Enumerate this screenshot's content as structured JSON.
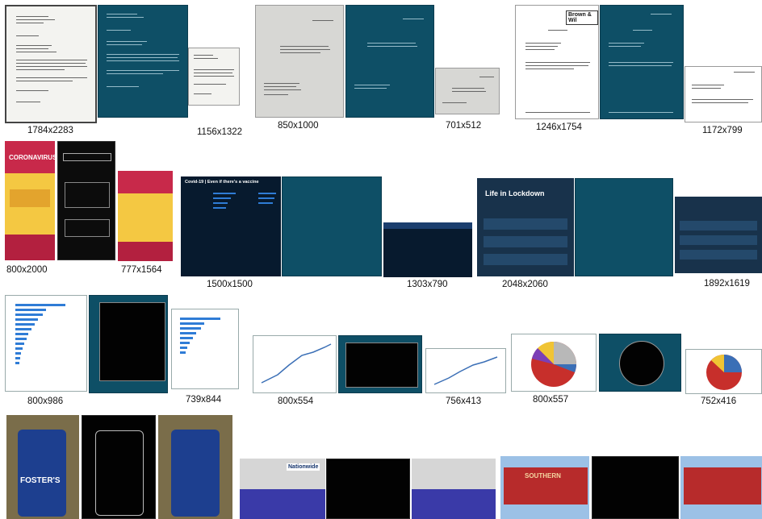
{
  "captions": {
    "r1": [
      "1784x2283",
      "1156x1322",
      "850x1000",
      "701x512",
      "1246x1754",
      "1172x799"
    ],
    "r2": [
      "800x2000",
      "777x1564",
      "1500x1500",
      "1303x790",
      "2048x2060",
      "1892x1619"
    ],
    "r3": [
      "800x986",
      "739x844",
      "800x554",
      "756x413",
      "800x557",
      "752x416"
    ]
  },
  "thumbnail_text": {
    "coronavirus_title": "CORONAVIRUS",
    "covid_title": "Covid-19 | Even if there's a vaccine",
    "lockdown_title": "Life in Lockdown",
    "letterhead_brand": "Brown & Wil",
    "fosters": "FOSTER'S",
    "nationwide": "Nationwide",
    "southern": "SOUTHERN"
  },
  "colors": {
    "dark_panel": "#0e4f66",
    "infographic_yellow": "#f4c842",
    "infographic_navy": "#18324b",
    "line_chart": "#3b6fb6",
    "bar_chart": "#2f7cd6"
  }
}
